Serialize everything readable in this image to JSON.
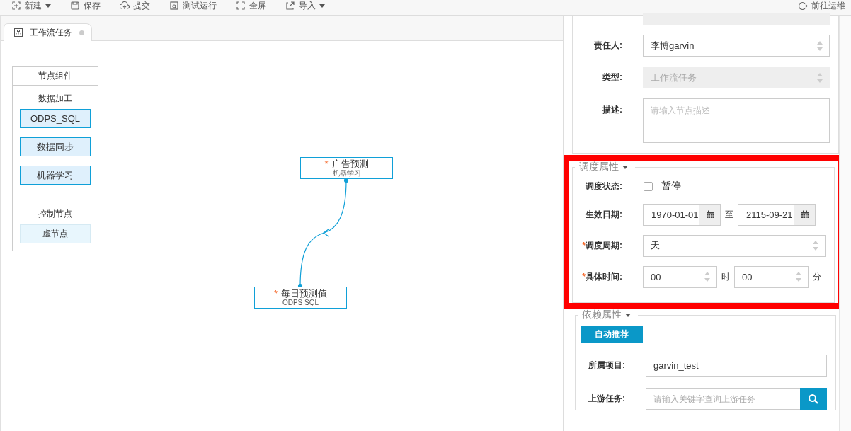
{
  "toolbar": {
    "items": [
      {
        "label": "新建",
        "caret": true
      },
      {
        "label": "保存",
        "caret": false
      },
      {
        "label": "提交",
        "caret": false
      },
      {
        "label": "测试运行",
        "caret": false
      },
      {
        "label": "全屏",
        "caret": false
      },
      {
        "label": "导入",
        "caret": true
      }
    ],
    "right_link": "前往运维"
  },
  "tabs": [
    {
      "label": "工作流任务",
      "selected": true
    }
  ],
  "palette": {
    "title": "节点组件",
    "groups": [
      {
        "title": "数据加工",
        "items": [
          {
            "label": "ODPS_SQL",
            "kind": "task"
          },
          {
            "label": "数据同步",
            "kind": "task"
          },
          {
            "label": "机器学习",
            "kind": "task"
          }
        ]
      },
      {
        "title": "控制节点",
        "items": [
          {
            "label": "虚节点",
            "kind": "virtual"
          }
        ]
      }
    ]
  },
  "canvas": {
    "nodes": [
      {
        "required_mark": "*",
        "name": "广告预测",
        "type": "机器学习"
      },
      {
        "required_mark": "*",
        "name": "每日预测值",
        "type": "ODPS SQL"
      }
    ]
  },
  "basic": {
    "fields": [
      {
        "label": "责任人:",
        "kind": "select",
        "value": "李博garvin",
        "disabled": false
      },
      {
        "label": "类型:",
        "kind": "select",
        "value": "工作流任务",
        "disabled": true
      },
      {
        "label": "描述:",
        "kind": "textarea",
        "placeholder": "请输入节点描述"
      }
    ]
  },
  "schedule": {
    "title": "调度属性",
    "highlighted": true,
    "fields": [
      {
        "label": "调度状态:",
        "kind": "checkbox",
        "checked": false,
        "option": "暂停"
      },
      {
        "label": "生效日期:",
        "kind": "daterange",
        "start": "1970-01-01",
        "separator": "至",
        "end": "2115-09-21"
      },
      {
        "required_mark": "*",
        "label": "调度周期:",
        "kind": "select",
        "value": "天",
        "disabled": false
      },
      {
        "required_mark": "*",
        "label": "具体时间:",
        "kind": "time",
        "hour": "00",
        "hour_unit": "时",
        "minute": "00",
        "minute_unit": "分"
      }
    ]
  },
  "dependency": {
    "title": "依赖属性",
    "button": "自动推荐",
    "fields": [
      {
        "label": "所属项目:",
        "kind": "text",
        "value": "garvin_test"
      },
      {
        "label": "上游任务:",
        "kind": "search",
        "placeholder": "请输入关键字查询上游任务"
      }
    ]
  }
}
